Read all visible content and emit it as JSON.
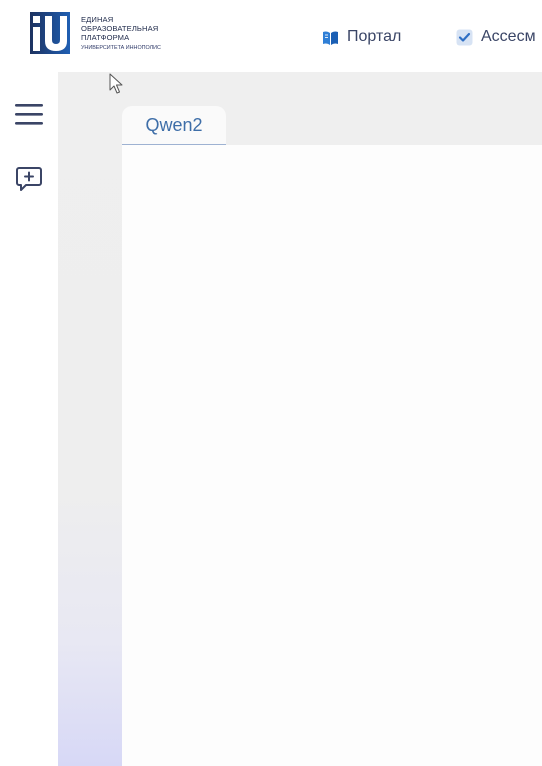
{
  "logo": {
    "line1": "ЕДИНАЯ",
    "line2": "ОБРАЗОВАТЕЛЬНАЯ",
    "line3": "ПЛАТФОРМА",
    "line4": "УНИВЕРСИТЕТА ИННОПОЛИС",
    "icon": "iu-logo"
  },
  "nav": {
    "portal": {
      "label": "Портал",
      "icon": "book-icon"
    },
    "assessment": {
      "label": "Ассесм",
      "icon": "checkbox-icon"
    }
  },
  "sidebar": {
    "items": [
      {
        "icon": "hamburger-menu-icon"
      },
      {
        "icon": "chat-add-icon"
      }
    ]
  },
  "tabs": [
    {
      "label": "Qwen2"
    }
  ],
  "colors": {
    "accent": "#3e6ea8",
    "navy": "#1f2a4a",
    "logo_blue": "#1e5aa8",
    "sidebar_icon": "#3b4566"
  }
}
